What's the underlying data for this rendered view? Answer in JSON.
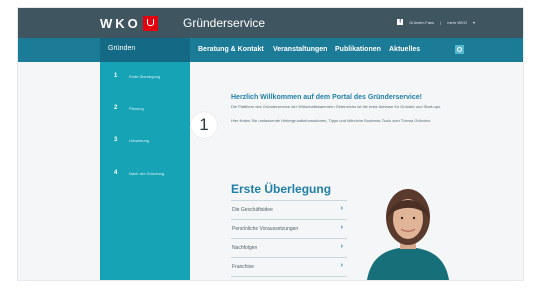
{
  "header": {
    "logo_text": "WKO",
    "brand": "Gründerservice",
    "top_links": [
      "Gründer-Fans",
      "mehr WKO"
    ]
  },
  "nav": {
    "left_label": "Gründen",
    "items": [
      "Beratung & Kontakt",
      "Veranstaltungen",
      "Publikationen",
      "Aktuelles"
    ]
  },
  "sidebar": {
    "steps": [
      {
        "num": "1",
        "label": "Erste Überlegung"
      },
      {
        "num": "2",
        "label": "Planung"
      },
      {
        "num": "3",
        "label": "Umsetzung"
      },
      {
        "num": "4",
        "label": "Nach der Gründung"
      }
    ]
  },
  "content": {
    "big_step_number": "1",
    "welcome_title": "Herzlich Willkommen auf dem Portal des Gründerservice!",
    "paragraphs": [
      "Die Plattform des Gründerservice der Wirtschaftskammern Österreichs ist die erste Adresse für Gründer und Start-ups.",
      "Hier finden Sie umfassende Hintergrundinformationen, Tipps und hilfreiche Business-Tools zum Thema Gründen."
    ],
    "section_title": "Erste Überlegung",
    "list_items": [
      "Die Geschäftsidee",
      "Persönliche Voraussetzungen",
      "Nachfolgen",
      "Franchise"
    ],
    "chevron": "›"
  },
  "colors": {
    "topbar": "#3f5560",
    "navbar": "#1c7c97",
    "sidebar": "#17a3b6",
    "accent": "#1f7fa7",
    "brand_red": "#e3000f"
  }
}
